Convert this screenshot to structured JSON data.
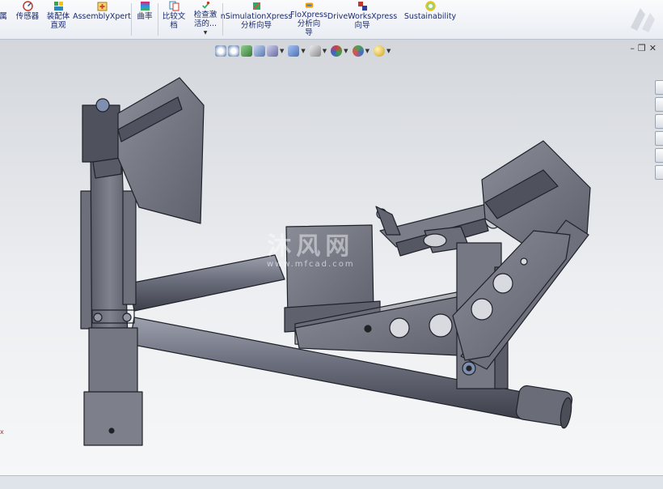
{
  "ribbon": {
    "tools": [
      {
        "label": "属",
        "icon": "properties-icon",
        "color": "#7c8ac0"
      },
      {
        "label": "传感器",
        "icon": "sensor-icon",
        "color": "#c0392b"
      },
      {
        "label": "装配体\n直观",
        "icon": "assembly-visualization-icon",
        "color": "#3fa34d"
      },
      {
        "label": "AssemblyXpert",
        "icon": "assemblyxpert-icon",
        "color": "#d8452f"
      },
      {
        "label": "曲率",
        "icon": "curvature-icon",
        "color": "#8e44ad"
      },
      {
        "label": "比较文\n档",
        "icon": "compare-documents-icon",
        "color": "#2e86c1"
      },
      {
        "label": "检查激\n活的...",
        "icon": "check-active-icon",
        "color": "#c0392b"
      },
      {
        "label": "nSimulationXpress\n分析向导",
        "icon": "simulationxpress-icon",
        "color": "#27ae60"
      },
      {
        "label": "FloXpress\n分析向\n导",
        "icon": "floxpress-icon",
        "color": "#e67e22"
      },
      {
        "label": "DriveWorksXpress\n向导",
        "icon": "driveworksxpress-icon",
        "color": "#2c3e9e"
      },
      {
        "label": "Sustainability",
        "icon": "sustainability-icon",
        "color": "#f1c40f"
      }
    ]
  },
  "hud": {
    "buttons": [
      {
        "name": "zoom-to-fit-icon",
        "color": "#4a6fa5"
      },
      {
        "name": "zoom-to-area-icon",
        "color": "#4a6fa5"
      },
      {
        "name": "previous-view-icon",
        "color": "#3a7a3a"
      },
      {
        "name": "section-view-icon",
        "color": "#5a78b0"
      },
      {
        "name": "view-orientation-icon",
        "color": "#6a6aa0"
      },
      {
        "name": "display-style-icon",
        "color": "#4a70b8"
      },
      {
        "name": "hide-show-items-icon",
        "color": "#888888"
      },
      {
        "name": "edit-appearance-icon",
        "color": "#d04040"
      },
      {
        "name": "apply-scene-icon",
        "color": "#50a050"
      },
      {
        "name": "view-settings-icon",
        "color": "#d0a020"
      }
    ]
  },
  "watermark": {
    "title": "沐风网",
    "url": "www.mfcad.com"
  },
  "origin_label": "x"
}
